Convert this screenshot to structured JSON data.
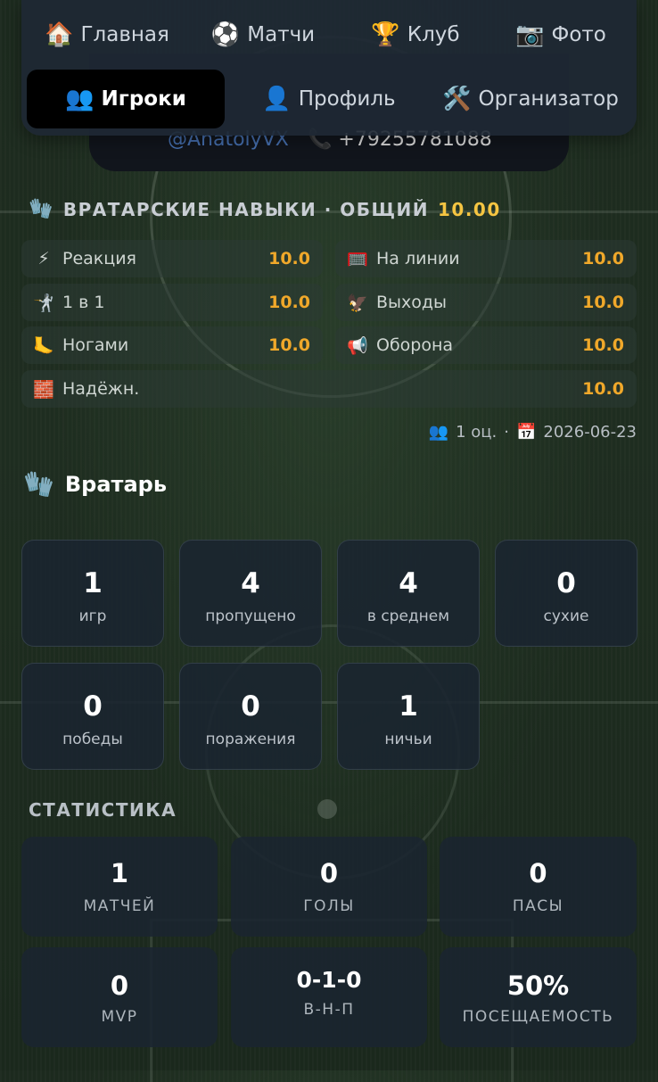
{
  "nav": {
    "items": [
      {
        "icon": "🏠",
        "label": "Главная"
      },
      {
        "icon": "⚽",
        "label": "Матчи"
      },
      {
        "icon": "🏆",
        "label": "Клуб"
      },
      {
        "icon": "📷",
        "label": "Фото"
      },
      {
        "icon": "👥",
        "label": "Игроки",
        "active": true
      },
      {
        "icon": "👤",
        "label": "Профиль"
      },
      {
        "icon": "🛠️",
        "label": "Организатор"
      }
    ]
  },
  "profile": {
    "handle": "@AnatolyVX",
    "phone_icon": "📞",
    "phone": "+79255781088"
  },
  "skills": {
    "icon": "🧤",
    "title": "ВРАТАРСКИЕ НАВЫКИ · ОБЩИЙ",
    "overall": "10.00",
    "items": [
      {
        "icon": "⚡",
        "label": "Реакция",
        "value": "10.0"
      },
      {
        "icon": "🥅",
        "label": "На линии",
        "value": "10.0"
      },
      {
        "icon": "🤺",
        "label": "1 в 1",
        "value": "10.0"
      },
      {
        "icon": "🦅",
        "label": "Выходы",
        "value": "10.0"
      },
      {
        "icon": "🦶",
        "label": "Ногами",
        "value": "10.0"
      },
      {
        "icon": "📢",
        "label": "Оборона",
        "value": "10.0"
      },
      {
        "icon": "🧱",
        "label": "Надёжн.",
        "value": "10.0"
      }
    ],
    "meta": {
      "raters_icon": "👥",
      "raters": "1 оц.",
      "sep": "·",
      "date_icon": "📅",
      "date": "2026-06-23"
    }
  },
  "role": {
    "icon": "🧤",
    "label": "Вратарь"
  },
  "gk_stats": [
    {
      "value": "1",
      "label": "игр"
    },
    {
      "value": "4",
      "label": "пропущено"
    },
    {
      "value": "4",
      "label": "в среднем"
    },
    {
      "value": "0",
      "label": "сухие"
    },
    {
      "value": "0",
      "label": "победы"
    },
    {
      "value": "0",
      "label": "поражения"
    },
    {
      "value": "1",
      "label": "ничьи"
    }
  ],
  "stats_section": {
    "title": "СТАТИСТИКА",
    "items": [
      {
        "value": "1",
        "label": "МАТЧЕЙ"
      },
      {
        "value": "0",
        "label": "ГОЛЫ"
      },
      {
        "value": "0",
        "label": "ПАСЫ"
      },
      {
        "value": "0",
        "label": "MVP"
      },
      {
        "value": "0-1-0",
        "label": "В-Н-П"
      },
      {
        "value": "50%",
        "label": "ПОСЕЩАЕМОСТЬ"
      }
    ]
  },
  "colors": {
    "accent": "#f0a82a",
    "gold": "#f5c542",
    "card": "#1a2430",
    "nav": "#1e2834"
  }
}
